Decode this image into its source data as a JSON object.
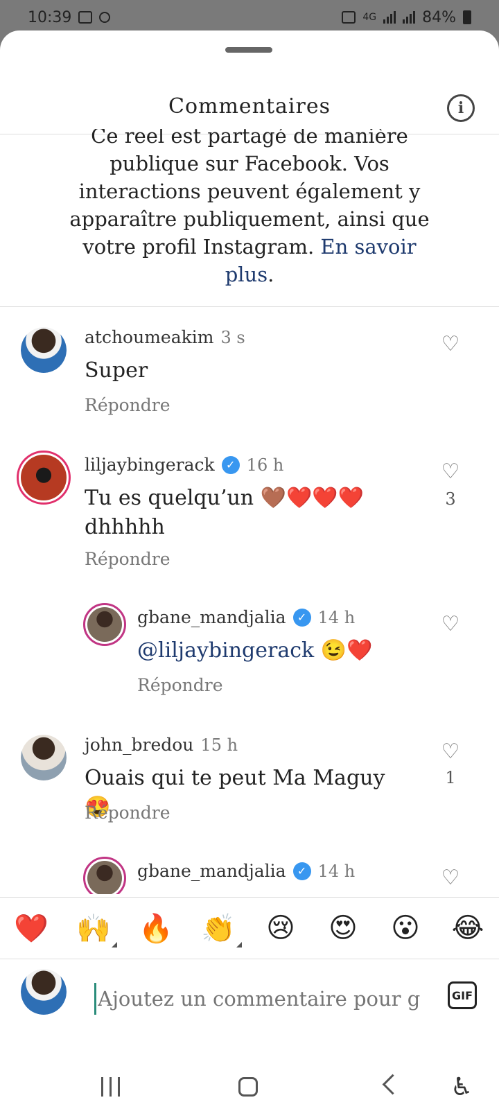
{
  "status_bar": {
    "time": "10:39",
    "network": "4G",
    "battery": "84%"
  },
  "header": {
    "title": "Commentaires",
    "info_icon": "info-icon"
  },
  "notice": {
    "text": "Ce reel est partagé de manière publique sur Facebook. Vos interactions peuvent également y apparaître publiquement, ainsi que votre profil Instagram.",
    "link": "En savoir plus",
    "end": "."
  },
  "comments": [
    {
      "username": "atchoumeakim",
      "time": "3 s",
      "verified": false,
      "text": "Super",
      "reply": "Répondre",
      "likes": ""
    },
    {
      "username": "liljaybingerack",
      "time": "16 h",
      "verified": true,
      "text": "Tu es quelqu’un 🤎❤️❤️❤️ dhhhhh",
      "reply": "Répondre",
      "likes": "3"
    },
    {
      "username": "gbane_mandjalia",
      "time": "14 h",
      "verified": true,
      "mention": "@liljaybingerack",
      "text": " 😉❤️",
      "reply": "Répondre",
      "likes": ""
    },
    {
      "username": "john_bredou",
      "time": "15 h",
      "verified": false,
      "text": "Ouais qui te peut Ma Maguy 😍",
      "reply": "Répondre",
      "likes": "1"
    },
    {
      "username": "gbane_mandjalia",
      "time": "14 h",
      "verified": true
    }
  ],
  "emoji_bar": [
    "❤️",
    "🙌",
    "🔥",
    "👏",
    "😢",
    "😍",
    "😮",
    "😂"
  ],
  "composer": {
    "placeholder": "Ajoutez un commentaire pour g",
    "gif_label": "GIF"
  },
  "colors": {
    "link": "#1e3a6e",
    "verified": "#3897f0",
    "story_ring": "#e1306c"
  }
}
